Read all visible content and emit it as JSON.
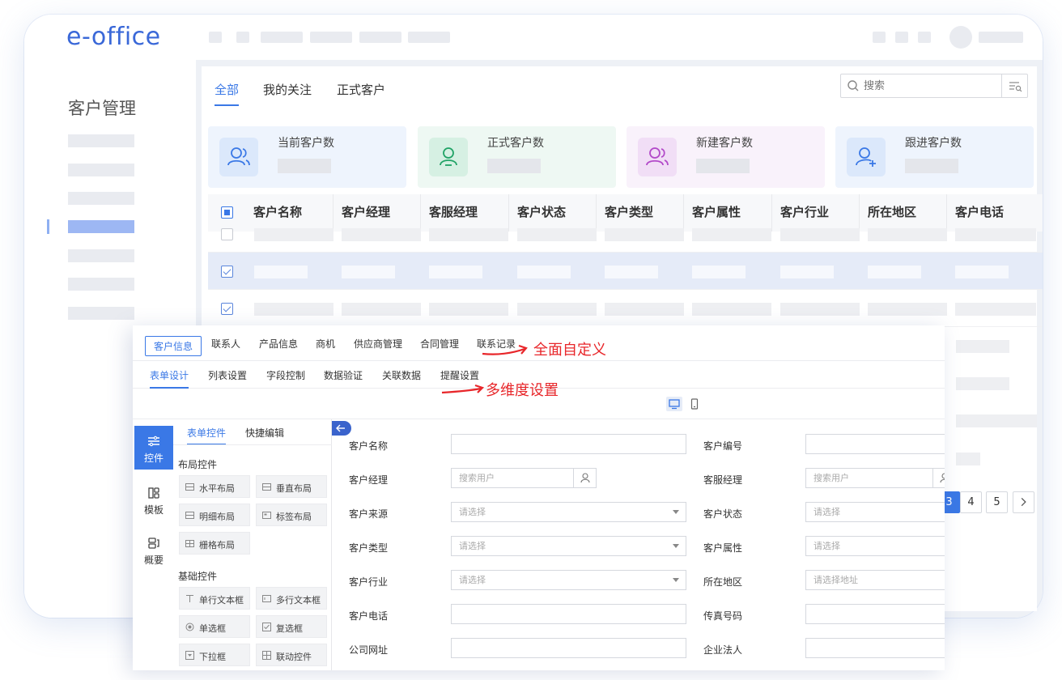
{
  "app": {
    "logo": "e-office"
  },
  "sidebar": {
    "title": "客户管理"
  },
  "main": {
    "tabs": [
      "全部",
      "我的关注",
      "正式客户"
    ],
    "search": {
      "placeholder": "搜索"
    },
    "stats": [
      {
        "label": "当前客户数",
        "bg": "#eef4fd",
        "icon_bg": "#dbe8fb",
        "icon_color": "#3a78e6"
      },
      {
        "label": "正式客户数",
        "bg": "#eef8f3",
        "icon_bg": "#d6f0e3",
        "icon_color": "#21a366"
      },
      {
        "label": "新建客户数",
        "bg": "#f9f2fb",
        "icon_bg": "#f1def6",
        "icon_color": "#b249c9"
      },
      {
        "label": "跟进客户数",
        "bg": "#eef4fd",
        "icon_bg": "#dbe8fb",
        "icon_color": "#3a78e6"
      }
    ],
    "table": {
      "headers": [
        "客户名称",
        "客户经理",
        "客服经理",
        "客户状态",
        "客户类型",
        "客户属性",
        "客户行业",
        "所在地区",
        "客户电话"
      ]
    },
    "pagination": [
      "3",
      "4",
      "5"
    ]
  },
  "editor": {
    "tabs": [
      "客户信息",
      "联系人",
      "产品信息",
      "商机",
      "供应商管理",
      "合同管理",
      "联系记录"
    ],
    "subtabs": [
      "表单设计",
      "列表设置",
      "字段控制",
      "数据验证",
      "关联数据",
      "提醒设置"
    ],
    "annotations": [
      "全面自定义",
      "多维度设置"
    ],
    "rail": [
      "控件",
      "模板",
      "概要"
    ],
    "ctrl_tabs": [
      "表单控件",
      "快捷编辑"
    ],
    "groups": {
      "layout_title": "布局控件",
      "layout": [
        "水平布局",
        "垂直布局",
        "明细布局",
        "标签布局",
        "栅格布局"
      ],
      "basic_title": "基础控件",
      "basic": [
        "单行文本框",
        "多行文本框",
        "单选框",
        "复选框",
        "下拉框",
        "联动控件"
      ]
    },
    "form": {
      "left": [
        {
          "label": "客户名称",
          "value": ""
        },
        {
          "label": "客户经理",
          "value": "搜索用户"
        },
        {
          "label": "客户来源",
          "value": "请选择"
        },
        {
          "label": "客户类型",
          "value": "请选择"
        },
        {
          "label": "客户行业",
          "value": "请选择"
        },
        {
          "label": "客户电话",
          "value": ""
        },
        {
          "label": "公司网址",
          "value": ""
        }
      ],
      "right": [
        {
          "label": "客户编号",
          "value": ""
        },
        {
          "label": "客服经理",
          "value": "搜索用户"
        },
        {
          "label": "客户状态",
          "value": "请选择"
        },
        {
          "label": "客户属性",
          "value": "请选择"
        },
        {
          "label": "所在地区",
          "value": "请选择地址"
        },
        {
          "label": "传真号码",
          "value": ""
        },
        {
          "label": "企业法人",
          "value": ""
        }
      ]
    }
  }
}
